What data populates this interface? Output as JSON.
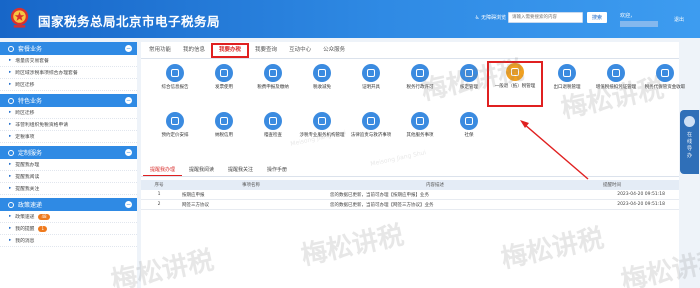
{
  "header": {
    "title": "国家税务总局北京市电子税务局",
    "screen_reader": "无障碍浏览",
    "search_placeholder": "请输入需要搜索的内容",
    "search_button": "搜索",
    "welcome": "欢迎，",
    "logout": "退出"
  },
  "sidebar": {
    "sections": [
      {
        "title": "套餐业务",
        "items": [
          {
            "label": "增量房交易套餐"
          },
          {
            "label": "跨区域涉税事项综合办理套餐"
          },
          {
            "label": "跨区迁移"
          }
        ]
      },
      {
        "title": "特色业务",
        "items": [
          {
            "label": "跨区迁移"
          },
          {
            "label": "非营利组织免税资格申请"
          },
          {
            "label": "定税事项"
          }
        ]
      },
      {
        "title": "定制服务",
        "items": [
          {
            "label": "提醒我办理"
          },
          {
            "label": "提醒我阅读"
          },
          {
            "label": "提醒我关注"
          }
        ]
      },
      {
        "title": "政策速递",
        "items": [
          {
            "label": "政策速递",
            "badge": "48"
          },
          {
            "label": "我的提醒",
            "badge": "1"
          },
          {
            "label": "我的消息"
          }
        ]
      }
    ]
  },
  "tabs": [
    "常用功能",
    "我的信息",
    "我要办税",
    "我要查询",
    "互动中心",
    "公众服务"
  ],
  "active_tab": "我要办税",
  "services": [
    {
      "label": "综合信息报告",
      "icon": "report-icon",
      "color": "#3b8be0"
    },
    {
      "label": "发票使用",
      "icon": "invoice-icon",
      "color": "#3b8be0"
    },
    {
      "label": "税费申报及缴纳",
      "icon": "tax-payment-icon",
      "color": "#3b8be0"
    },
    {
      "label": "税收减免",
      "icon": "tax-reduction-icon",
      "color": "#3b8be0"
    },
    {
      "label": "证明开具",
      "icon": "certificate-icon",
      "color": "#3b8be0"
    },
    {
      "label": "税务行政许可",
      "icon": "license-icon",
      "color": "#3b8be0"
    },
    {
      "label": "核定管理",
      "icon": "verification-icon",
      "color": "#3b8be0"
    },
    {
      "label": "一般退（抵）税管理",
      "icon": "refund-icon",
      "color": "#f0a020"
    },
    {
      "label": "出口退税管理",
      "icon": "globe-icon",
      "color": "#3b8be0"
    },
    {
      "label": "增值税抵扣凭证管理",
      "icon": "voucher-icon",
      "color": "#3b8be0"
    },
    {
      "label": "税务代保管资金收取",
      "icon": "fund-icon",
      "color": "#3b8be0"
    },
    {
      "label": "预约定价安排",
      "icon": "pricing-icon",
      "color": "#3b8be0"
    },
    {
      "label": "纳税信用",
      "icon": "credit-icon",
      "color": "#3b8be0"
    },
    {
      "label": "稽查检查",
      "icon": "inspection-icon",
      "color": "#3b8be0"
    },
    {
      "label": "涉税专业服务机构管理",
      "icon": "agency-icon",
      "color": "#3b8be0"
    },
    {
      "label": "法律追责与救济事项",
      "icon": "law-icon",
      "color": "#3b8be0"
    },
    {
      "label": "其他服务事项",
      "icon": "other-icon",
      "color": "#3b8be0"
    },
    {
      "label": "社保",
      "icon": "social-security-icon",
      "color": "#3b8be0"
    }
  ],
  "sub_tabs": [
    "提醒我办理",
    "提醒我阅读",
    "提醒我关注",
    "操作手册"
  ],
  "table": {
    "columns": [
      "序号",
      "事项名称",
      "内容描述",
      "提醒时间"
    ],
    "rows": [
      {
        "no": "1",
        "name": "按期应申报",
        "desc": "您的数据已更新，当前可办理【按期应申报】业务",
        "time": "2023-04-20 09:51:18"
      },
      {
        "no": "2",
        "name": "网签三方协议",
        "desc": "您的数据已更新，当前可办理【网签三方协议】业务",
        "time": "2023-04-20 09:51:18"
      }
    ]
  },
  "float_button": "在线导办",
  "watermark": {
    "text": "梅松讲税",
    "sub": "Meisong Jiang Shui"
  }
}
